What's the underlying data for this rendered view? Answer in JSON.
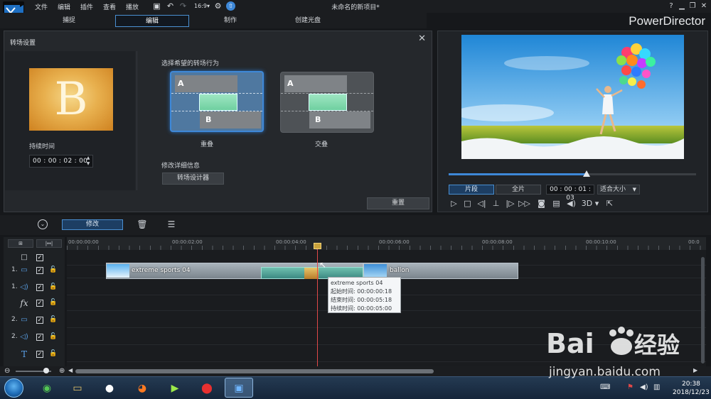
{
  "window": {
    "menu": [
      "文件",
      "编辑",
      "插件",
      "查看",
      "播放"
    ],
    "project_title": "未命名的新项目*",
    "app_name": "PowerDirector",
    "help": "?"
  },
  "modes": [
    "捕捉",
    "编辑",
    "制作",
    "创建光盘"
  ],
  "transition": {
    "panel_title": "转场设置",
    "thumb_letter": "B",
    "duration_label": "持续时间",
    "duration_value": "00 : 00 : 02 : 00",
    "behavior_label": "选择希望的转场行为",
    "card_a": "A",
    "card_b": "B",
    "option_overlap": "重叠",
    "option_crossfade": "交叠",
    "modify_label": "修改详细信息",
    "designer_button": "转场设计器",
    "reset_button": "重置"
  },
  "preview": {
    "clip_button": "片段",
    "full_button": "全片",
    "timecode": "00 : 00 : 01 : 03",
    "fit_select": "适合大小",
    "mode_3d": "3D",
    "scrub_progress": 0.557
  },
  "timeline": {
    "modify_button": "修改",
    "ruler_ticks": [
      "00:00:00:00",
      "00:00:02:00",
      "00:00:04:00",
      "00:00:06:00",
      "00:00:08:00",
      "00:00:10:00",
      "00:0"
    ],
    "tracks": [
      {
        "num": "",
        "icon": "master-track-icon"
      },
      {
        "num": "1.",
        "icon": "video-track-icon"
      },
      {
        "num": "1.",
        "icon": "audio-track-icon"
      },
      {
        "num": "",
        "icon": "fx-track-icon",
        "glyph": "fx"
      },
      {
        "num": "2.",
        "icon": "video-track-icon"
      },
      {
        "num": "2.",
        "icon": "audio-track-icon"
      },
      {
        "num": "",
        "icon": "title-track-icon",
        "glyph": "T"
      }
    ],
    "clip1_name": "extreme sports 04",
    "clip2_name": "ballon",
    "tooltip": {
      "title": "extreme sports 04",
      "start": "起始时间: 00:00:00:18",
      "end": "结束时间: 00:00:05:18",
      "duration": "持续时间:  00:00:05:00"
    }
  },
  "taskbar": {
    "time": "20:38",
    "date": "2018/12/23"
  },
  "watermark": {
    "brand": "Bai du 经验",
    "url": "jingyan.baidu.com"
  },
  "colors": {
    "accent": "#3e88d8",
    "playhead": "#e04848",
    "transition": "#6fcfa0"
  }
}
